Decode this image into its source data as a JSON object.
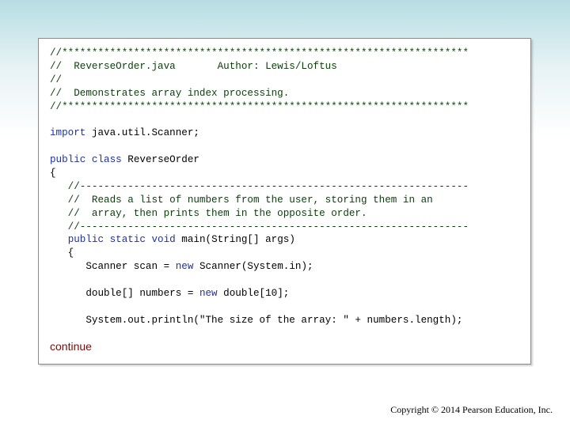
{
  "code": {
    "line01": "//********************************************************************",
    "line02": "//  ReverseOrder.java       Author: Lewis/Loftus",
    "line03": "//",
    "line04": "//  Demonstrates array index processing.",
    "line05": "//********************************************************************",
    "line06": "",
    "line07": "import java.util.Scanner;",
    "line08": "",
    "line09_kw1": "public",
    "line09_kw2": "class",
    "line09_rest": "ReverseOrder",
    "line10": "{",
    "line11": "   //-----------------------------------------------------------------",
    "line12": "   //  Reads a list of numbers from the user, storing them in an",
    "line13": "   //  array, then prints them in the opposite order.",
    "line14": "   //-----------------------------------------------------------------",
    "line15_indent": "   ",
    "line15_kw": "public static void",
    "line15_rest": "main(String[] args)",
    "line16": "   {",
    "line17_pre": "      Scanner scan = ",
    "line17_kw": "new",
    "line17_post": " Scanner(System.in);",
    "line18": "",
    "line19_pre": "      double[] numbers = ",
    "line19_kw": "new",
    "line19_post": " double[10];",
    "line20": "",
    "line21": "      System.out.println(\"The size of the array: \" + numbers.length);"
  },
  "continue_label": "continue",
  "copyright": "Copyright © 2014 Pearson Education, Inc."
}
